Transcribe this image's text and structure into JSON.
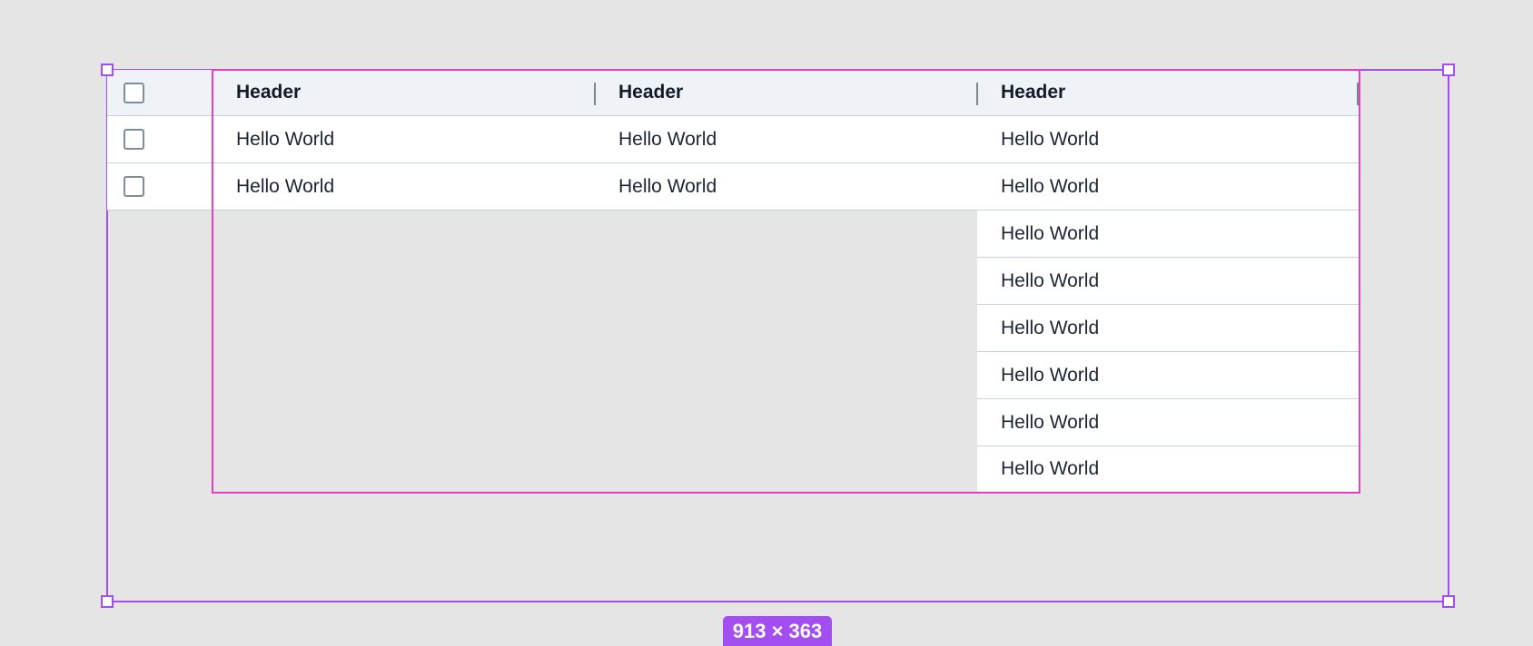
{
  "table": {
    "headers": [
      "Header",
      "Header",
      "Header"
    ],
    "rows": [
      [
        "Hello World",
        "Hello World",
        "Hello World"
      ],
      [
        "Hello World",
        "Hello World",
        "Hello World"
      ]
    ],
    "overflow_column_cells": [
      "Hello World",
      "Hello World",
      "Hello World",
      "Hello World",
      "Hello World",
      "Hello World"
    ]
  },
  "selection": {
    "size_label": "913 × 363",
    "frame_color": "#a34ef0",
    "component_color": "#e23fc5"
  }
}
